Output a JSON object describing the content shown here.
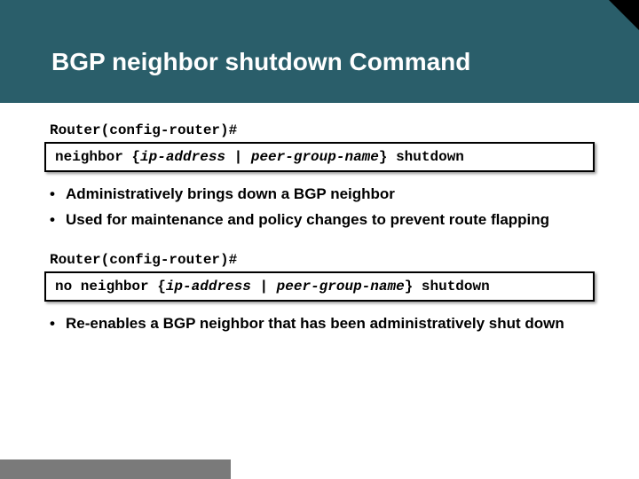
{
  "title": "BGP neighbor shutdown Command",
  "block1": {
    "prompt": "Router(config-router)#",
    "cmd_prefix": "neighbor {",
    "cmd_param1": "ip-address",
    "cmd_sep": " | ",
    "cmd_param2": "peer-group-name",
    "cmd_suffix": "} shutdown",
    "bullets": [
      "Administratively brings down a BGP neighbor",
      "Used for maintenance and policy changes to prevent route flapping"
    ]
  },
  "block2": {
    "prompt": "Router(config-router)#",
    "cmd_prefix": "no neighbor {",
    "cmd_param1": "ip-address",
    "cmd_sep": " | ",
    "cmd_param2": "peer-group-name",
    "cmd_suffix": "} shutdown",
    "bullets": [
      "Re-enables a BGP neighbor that has been administratively shut down"
    ]
  }
}
